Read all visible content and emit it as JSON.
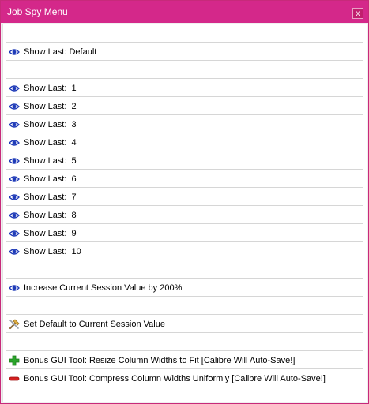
{
  "window": {
    "title": "Job Spy Menu",
    "close_label": "x"
  },
  "menu": {
    "default_item": {
      "label": "Show Last: Default",
      "icon": "eye-icon"
    },
    "numbered_items": [
      {
        "label": "Show Last:  1",
        "icon": "eye-icon"
      },
      {
        "label": "Show Last:  2",
        "icon": "eye-icon"
      },
      {
        "label": "Show Last:  3",
        "icon": "eye-icon"
      },
      {
        "label": "Show Last:  4",
        "icon": "eye-icon"
      },
      {
        "label": "Show Last:  5",
        "icon": "eye-icon"
      },
      {
        "label": "Show Last:  6",
        "icon": "eye-icon"
      },
      {
        "label": "Show Last:  7",
        "icon": "eye-icon"
      },
      {
        "label": "Show Last:  8",
        "icon": "eye-icon"
      },
      {
        "label": "Show Last:  9",
        "icon": "eye-icon"
      },
      {
        "label": "Show Last:  10",
        "icon": "eye-icon"
      }
    ],
    "increase_item": {
      "label": "Increase Current Session Value by 200%",
      "icon": "eye-icon"
    },
    "set_default_item": {
      "label": "Set Default to Current Session Value",
      "icon": "tools-icon"
    },
    "bonus_resize_item": {
      "label": "Bonus GUI Tool: Resize Column Widths to Fit [Calibre Will Auto-Save!]",
      "icon": "plus-icon"
    },
    "bonus_compress_item": {
      "label": "Bonus GUI Tool: Compress Column Widths Uniformly [Calibre Will Auto-Save!]",
      "icon": "minus-icon"
    }
  },
  "colors": {
    "title_bar": "#d4288a",
    "eye_blue": "#1f3bb8",
    "plus_green": "#2aa52a",
    "minus_red": "#d42020"
  }
}
